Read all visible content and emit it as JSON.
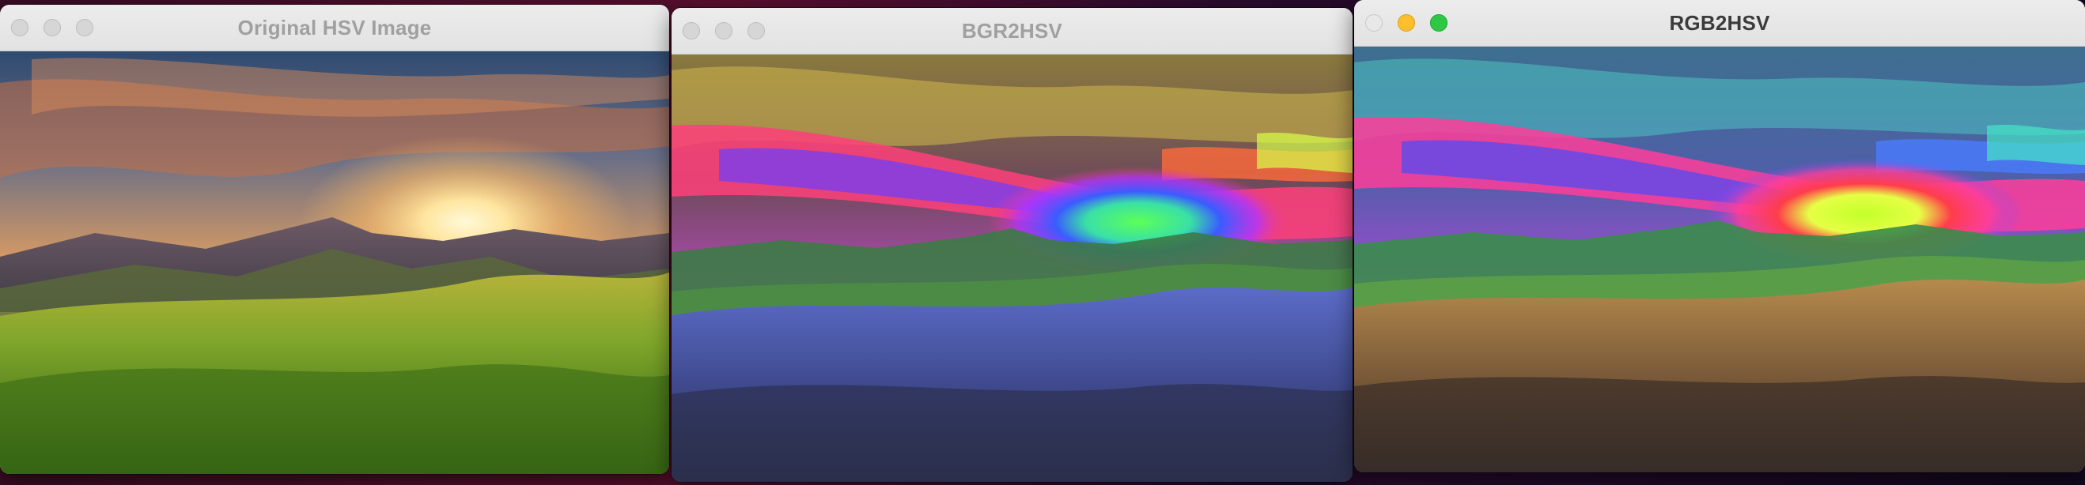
{
  "desktop": {
    "windows": [
      {
        "title": "Original HSV Image",
        "active": false
      },
      {
        "title": "BGR2HSV",
        "active": false
      },
      {
        "title": "RGB2HSV",
        "active": true
      }
    ]
  },
  "colors": {
    "original": {
      "sky": "#e69a4e",
      "sun": "#ffe7a1",
      "grass": "#7aa629",
      "hills": "#4c3d49"
    },
    "bgr2hsv": {
      "sky_band": "#ff3a7c",
      "sun_core": "#5bff4f",
      "hills": "#3c7b46",
      "grass": "#4b5fd6"
    },
    "rgb2hsv": {
      "sky_band": "#ff3d9a",
      "sun_core": "#a8ff2c",
      "hills": "#3a8c4b",
      "grass": "#b07a43"
    }
  }
}
